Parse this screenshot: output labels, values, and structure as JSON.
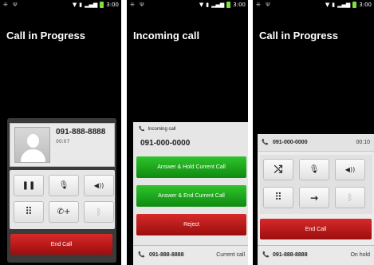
{
  "status_bar": {
    "time": "3:00"
  },
  "screen1": {
    "title": "Call in Progress",
    "caller_number": "091-888-8888",
    "call_duration": "00:07",
    "controls": [
      {
        "icon": "pause-icon",
        "glyph": "❚❚"
      },
      {
        "icon": "mute-microphone-icon",
        "glyph": "🎙"
      },
      {
        "icon": "speaker-icon",
        "glyph": "◀))"
      },
      {
        "icon": "dialpad-icon",
        "glyph": "⠿"
      },
      {
        "icon": "add-call-icon",
        "glyph": "✆+"
      },
      {
        "icon": "bluetooth-icon",
        "glyph": "ᛒ"
      }
    ],
    "end_call_label": "End Call"
  },
  "screen2": {
    "title": "Incoming call",
    "incoming_label": "Incoming call",
    "incoming_number": "091-000-0000",
    "answer_hold_label": "Answer & Hold Current Call",
    "answer_end_label": "Answer & End Current Call",
    "reject_label": "Reject",
    "current_number": "091-888-8888",
    "current_status": "Current call"
  },
  "screen3": {
    "title": "Call in Progress",
    "active_number": "091-000-0000",
    "active_duration": "00:10",
    "controls": [
      {
        "icon": "swap-calls-icon",
        "glyph": "⤭"
      },
      {
        "icon": "mute-microphone-icon",
        "glyph": "🎙"
      },
      {
        "icon": "speaker-icon",
        "glyph": "◀))"
      },
      {
        "icon": "dialpad-icon",
        "glyph": "⠿"
      },
      {
        "icon": "merge-calls-icon",
        "glyph": "→"
      },
      {
        "icon": "bluetooth-icon",
        "glyph": "ᛒ"
      }
    ],
    "end_call_label": "End Call",
    "held_number": "091-888-8888",
    "held_status": "On hold"
  },
  "colors": {
    "end_red": "#c41d1d",
    "answer_green": "#1faa1d",
    "battery_green": "#7ee23c"
  }
}
